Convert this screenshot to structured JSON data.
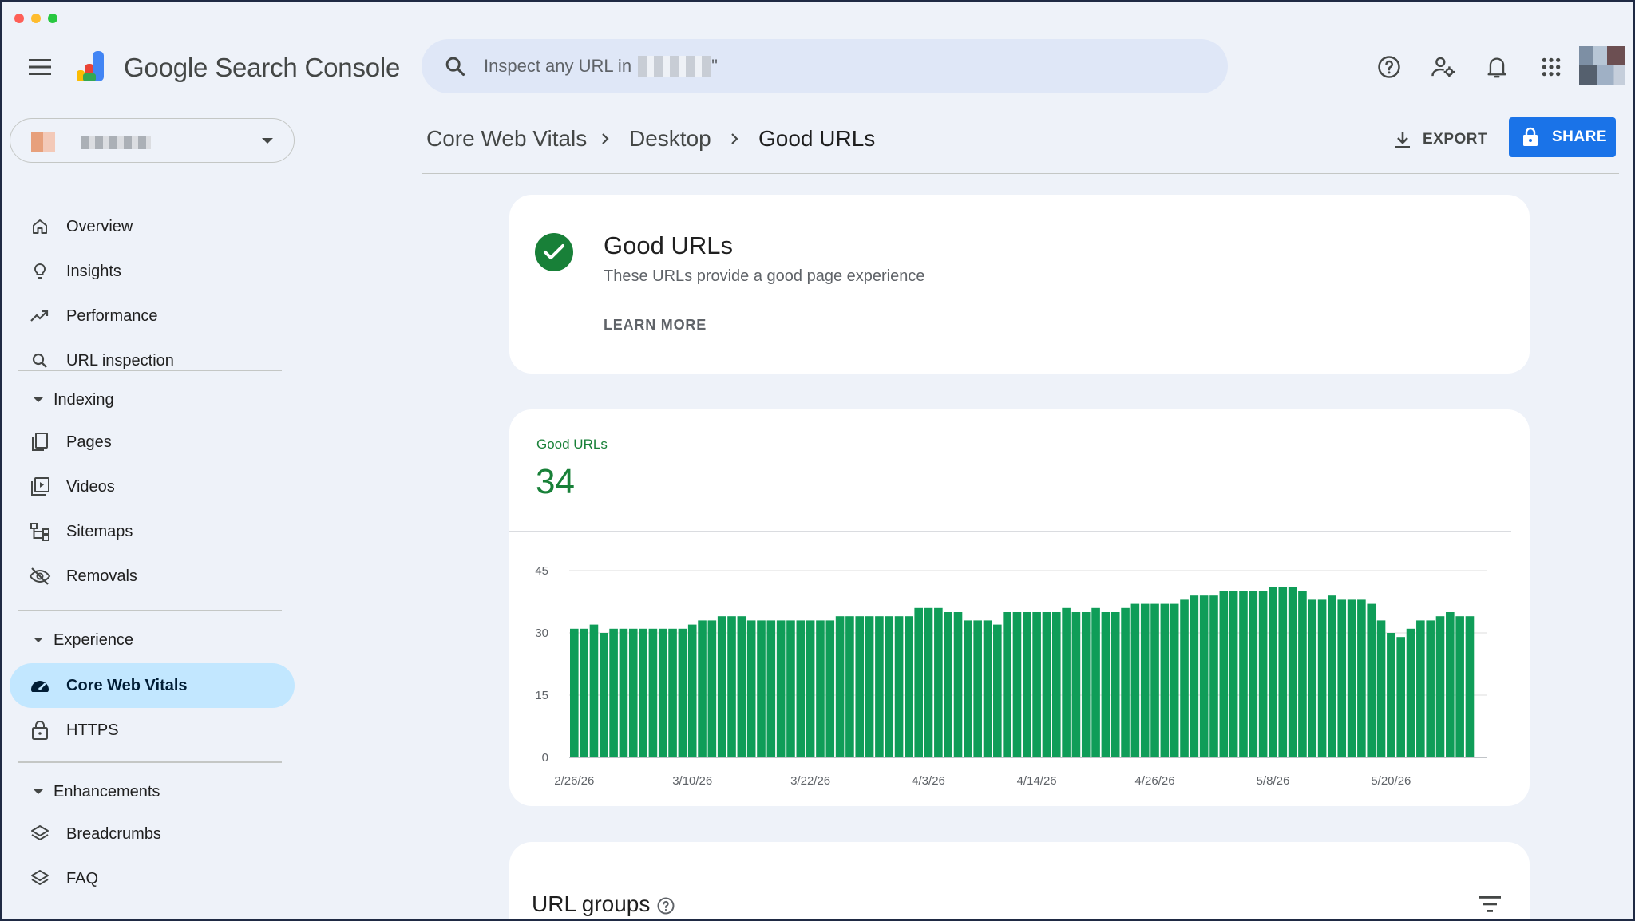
{
  "app": {
    "name_part1": "Google",
    "name_part2": "Search Console"
  },
  "search": {
    "placeholder": "Inspect any URL in",
    "quote": "\""
  },
  "header_icons": [
    "help-icon",
    "manage-users-icon",
    "notifications-icon",
    "apps-icon"
  ],
  "sidebar": {
    "top_items": [
      {
        "label": "Overview",
        "icon": "home-icon"
      },
      {
        "label": "Insights",
        "icon": "lightbulb-icon"
      },
      {
        "label": "Performance",
        "icon": "trending-up-icon"
      },
      {
        "label": "URL inspection",
        "icon": "search-icon"
      }
    ],
    "indexing": {
      "title": "Indexing",
      "items": [
        {
          "label": "Pages",
          "icon": "pages-icon"
        },
        {
          "label": "Videos",
          "icon": "video-library-icon"
        },
        {
          "label": "Sitemaps",
          "icon": "sitemap-icon"
        },
        {
          "label": "Removals",
          "icon": "visibility-off-icon"
        }
      ]
    },
    "experience": {
      "title": "Experience",
      "items": [
        {
          "label": "Core Web Vitals",
          "icon": "speed-gauge-icon",
          "active": true
        },
        {
          "label": "HTTPS",
          "icon": "lock-icon"
        }
      ]
    },
    "enhancements": {
      "title": "Enhancements",
      "items": [
        {
          "label": "Breadcrumbs",
          "icon": "layers-icon"
        },
        {
          "label": "FAQ",
          "icon": "layers-icon"
        }
      ]
    }
  },
  "breadcrumb": [
    "Core Web Vitals",
    "Desktop",
    "Good URLs"
  ],
  "toolbar": {
    "export_label": "EXPORT",
    "share_label": "SHARE"
  },
  "status_card": {
    "title": "Good URLs",
    "subtitle": "These URLs provide a good page experience",
    "learn_more": "LEARN MORE"
  },
  "metric": {
    "label": "Good URLs",
    "value": "34"
  },
  "url_groups": {
    "title": "URL groups"
  },
  "colors": {
    "good_green": "#188038",
    "bar_green": "#0f9d58",
    "accent_blue": "#1a73e8",
    "active_nav": "#c2e7ff"
  },
  "chart_data": {
    "type": "bar",
    "series": [
      {
        "name": "Good URLs",
        "color": "#0f9d58"
      }
    ],
    "ylim": [
      0,
      45
    ],
    "yticks": [
      0,
      15,
      30,
      45
    ],
    "grid": true,
    "x_tick_labels": [
      "2/26/26",
      "3/10/26",
      "3/22/26",
      "4/3/26",
      "4/14/26",
      "4/26/26",
      "5/8/26",
      "5/20/26"
    ],
    "x_tick_index": [
      0,
      12,
      24,
      36,
      47,
      59,
      71,
      83
    ],
    "values": [
      31,
      31,
      32,
      30,
      31,
      31,
      31,
      31,
      31,
      31,
      31,
      31,
      32,
      33,
      33,
      34,
      34,
      34,
      33,
      33,
      33,
      33,
      33,
      33,
      33,
      33,
      33,
      34,
      34,
      34,
      34,
      34,
      34,
      34,
      34,
      36,
      36,
      36,
      35,
      35,
      33,
      33,
      33,
      32,
      35,
      35,
      35,
      35,
      35,
      35,
      36,
      35,
      35,
      36,
      35,
      35,
      36,
      37,
      37,
      37,
      37,
      37,
      38,
      39,
      39,
      39,
      40,
      40,
      40,
      40,
      40,
      41,
      41,
      41,
      40,
      38,
      38,
      39,
      38,
      38,
      38,
      37,
      33,
      30,
      29,
      31,
      33,
      33,
      34,
      35,
      34,
      34
    ]
  }
}
